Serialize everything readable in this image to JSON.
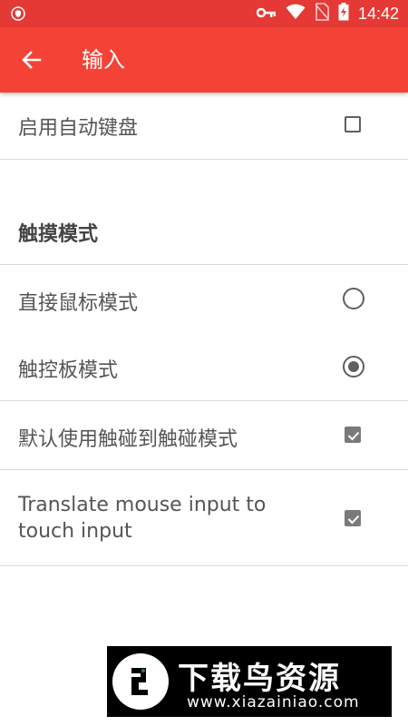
{
  "status_bar": {
    "time": "14:42",
    "icons": [
      "shield-icon",
      "key-icon",
      "wifi-icon",
      "no-sim-icon",
      "battery-charging-icon"
    ],
    "bg_color": "#e53935"
  },
  "app_bar": {
    "title": "输入",
    "back_icon": "arrow-left-icon",
    "bg_color": "#f44336"
  },
  "settings": {
    "auto_keyboard": {
      "label": "启用自动键盘",
      "checked": false
    },
    "touch_section_title": "触摸模式",
    "mouse_mode": {
      "label": "直接鼠标模式",
      "selected": false
    },
    "touchpad_mode": {
      "label": "触控板模式",
      "selected": true
    },
    "default_touch": {
      "label": "默认使用触碰到触碰模式",
      "checked": true
    },
    "translate_mouse": {
      "label_line1": "Translate mouse input to",
      "label_line2": "touch input",
      "checked": true
    }
  },
  "watermark": {
    "title": "下载鸟资源",
    "url": "www.xiazainiao.com"
  }
}
